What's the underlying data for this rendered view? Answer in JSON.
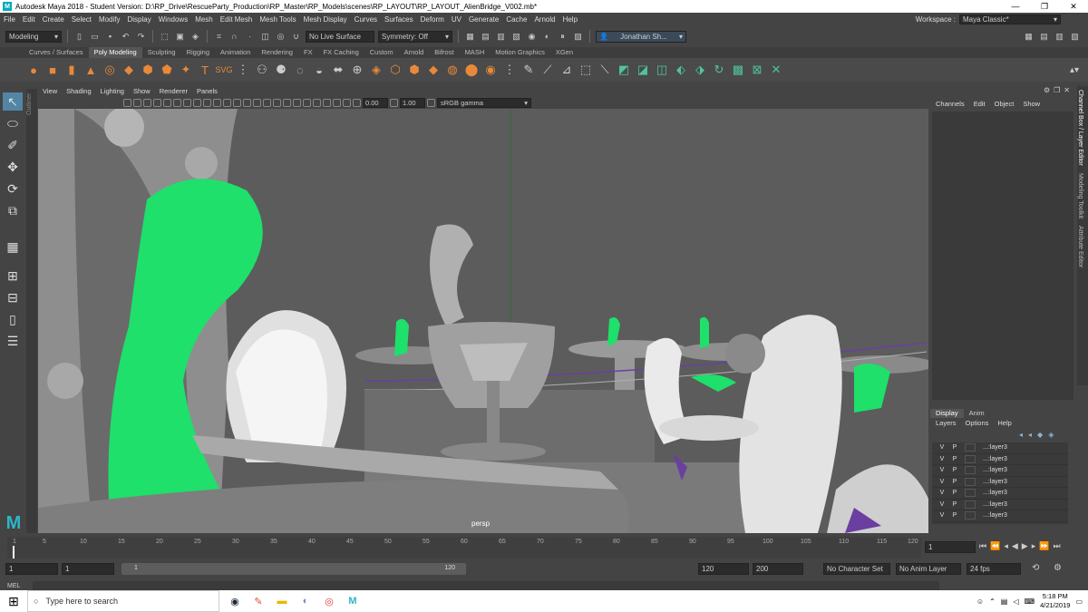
{
  "window": {
    "title": "Autodesk Maya 2018 - Student Version: D:\\RP_Drive\\RescueParty_Production\\RP_Master\\RP_Models\\scenes\\RP_LAYOUT\\RP_LAYOUT_AlienBridge_V002.mb*",
    "minimize": "—",
    "maximize": "❐",
    "close": "✕"
  },
  "menubar": {
    "items": [
      "File",
      "Edit",
      "Create",
      "Select",
      "Modify",
      "Display",
      "Windows",
      "Mesh",
      "Edit Mesh",
      "Mesh Tools",
      "Mesh Display",
      "Curves",
      "Surfaces",
      "Deform",
      "UV",
      "Generate",
      "Cache",
      "Arnold",
      "Help"
    ],
    "workspace_label": "Workspace :",
    "workspace_value": "Maya Classic*"
  },
  "statusline": {
    "mode": "Modeling",
    "live_surface": "No Live Surface",
    "symmetry": "Symmetry: Off",
    "user": "Jonathan Sh..."
  },
  "shelf": {
    "tabs": [
      "Curves / Surfaces",
      "Poly Modeling",
      "Sculpting",
      "Rigging",
      "Animation",
      "Rendering",
      "FX",
      "FX Caching",
      "Custom",
      "Arnold",
      "Bifrost",
      "MASH",
      "Motion Graphics",
      "XGen"
    ],
    "active_tab": "Poly Modeling"
  },
  "toolbox": {
    "outliner_label": "Outliner"
  },
  "viewport": {
    "menus": [
      "View",
      "Shading",
      "Lighting",
      "Show",
      "Renderer",
      "Panels"
    ],
    "exposure": "0.00",
    "gamma": "1.00",
    "color_space": "sRGB gamma",
    "camera": "persp"
  },
  "channel_box": {
    "menus": [
      "Channels",
      "Edit",
      "Object",
      "Show"
    ],
    "display_tabs": [
      "Display",
      "Anim"
    ],
    "active_display_tab": "Display",
    "layer_menus": [
      "Layers",
      "Options",
      "Help"
    ],
    "layers": [
      {
        "v": "V",
        "p": "P",
        "name": "...:layer3"
      },
      {
        "v": "V",
        "p": "P",
        "name": "...:layer3"
      },
      {
        "v": "V",
        "p": "P",
        "name": "...:layer3"
      },
      {
        "v": "V",
        "p": "P",
        "name": "...:layer3"
      },
      {
        "v": "V",
        "p": "P",
        "name": "...:layer3"
      },
      {
        "v": "V",
        "p": "P",
        "name": "...:layer3"
      },
      {
        "v": "V",
        "p": "P",
        "name": "...:layer3"
      }
    ],
    "side_tabs": [
      "Channel Box / Layer Editor",
      "Modeling Toolkit",
      "Attribute Editor"
    ]
  },
  "timeline": {
    "ticks": [
      "1",
      "5",
      "10",
      "15",
      "20",
      "25",
      "30",
      "35",
      "40",
      "45",
      "50",
      "55",
      "60",
      "65",
      "70",
      "75",
      "80",
      "85",
      "90",
      "95",
      "100",
      "105",
      "110",
      "115",
      "120"
    ],
    "current_frame": "1"
  },
  "range": {
    "start": "1",
    "playback_start": "1",
    "slider_start": "1",
    "slider_end": "120",
    "playback_end": "120",
    "end": "200",
    "character_set": "No Character Set",
    "anim_layer": "No Anim Layer",
    "fps": "24 fps"
  },
  "command_line": {
    "label": "MEL"
  },
  "taskbar": {
    "search_placeholder": "Type here to search",
    "time": "5:18 PM",
    "date": "4/21/2019"
  }
}
